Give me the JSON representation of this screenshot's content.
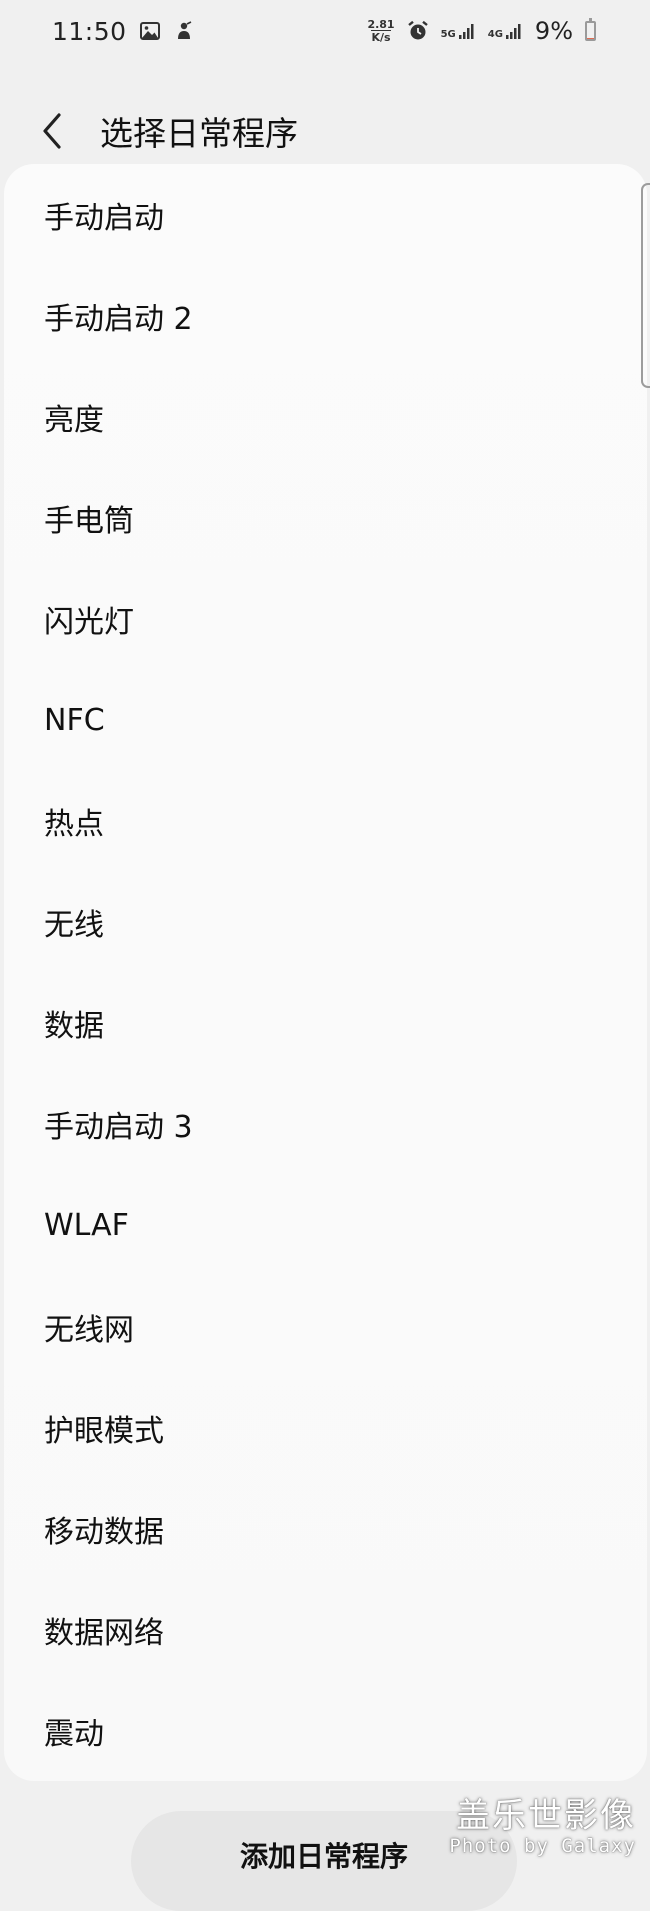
{
  "status_bar": {
    "time": "11:50",
    "left_icons": [
      "image-icon",
      "notification-app-icon"
    ],
    "net_speed_value": "2.81",
    "net_speed_unit": "K/s",
    "alarm_icon": "alarm-icon",
    "network_type": "5G",
    "network_type_2": "4G",
    "battery_text": "9%",
    "battery_level_percent": 9,
    "battery_color": "#e06b52"
  },
  "app_bar": {
    "back_icon": "chevron-left-icon",
    "title": "选择日常程序"
  },
  "routines": {
    "items": [
      {
        "label": "手动启动"
      },
      {
        "label": "手动启动 2"
      },
      {
        "label": "亮度"
      },
      {
        "label": "手电筒"
      },
      {
        "label": "闪光灯"
      },
      {
        "label": "NFC"
      },
      {
        "label": "热点"
      },
      {
        "label": "无线"
      },
      {
        "label": "数据"
      },
      {
        "label": "手动启动 3"
      },
      {
        "label": "WLAF"
      },
      {
        "label": "无线网"
      },
      {
        "label": "护眼模式"
      },
      {
        "label": "移动数据"
      },
      {
        "label": "数据网络"
      },
      {
        "label": "震动"
      }
    ]
  },
  "bottom": {
    "add_button_label": "添加日常程序"
  },
  "watermark": {
    "title": "盖乐世影像",
    "subtitle": "Photo by Galaxy"
  },
  "colors": {
    "background": "#f0f0f0",
    "card": "#fbfbfb",
    "button": "#e6e6e6",
    "text": "#111111"
  }
}
